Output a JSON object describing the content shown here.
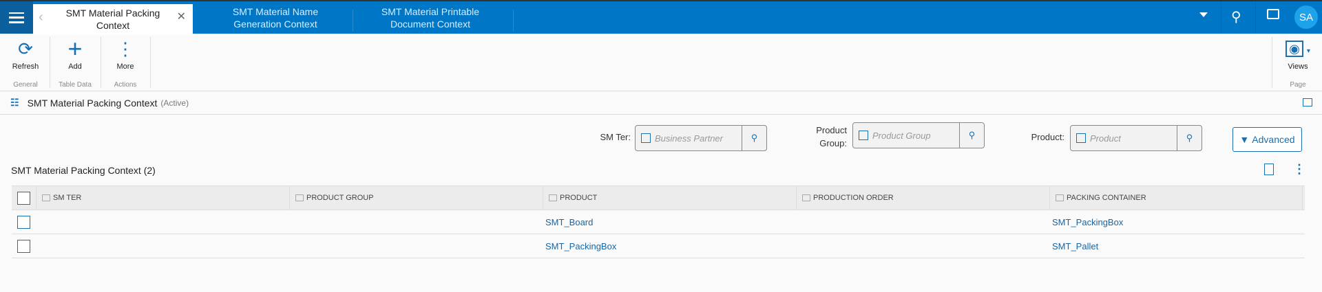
{
  "topbar": {
    "tabs": [
      {
        "label": "SMT Material Packing Context",
        "active": true
      },
      {
        "label": "SMT Material Name Generation Context"
      },
      {
        "label": "SMT Material Printable Document Context"
      }
    ],
    "avatar": "SA"
  },
  "toolbar": {
    "buttons": [
      {
        "label": "Refresh",
        "group": "General"
      },
      {
        "label": "Add",
        "group": "Table Data"
      },
      {
        "label": "More",
        "group": "Actions"
      },
      {
        "label": "Views",
        "group": "Page"
      }
    ]
  },
  "context": {
    "title": "SMT Material Packing Context",
    "status": "(Active)"
  },
  "filters": [
    {
      "label": "SM Ter:",
      "placeholder": "Business Partner"
    },
    {
      "label": "Product Group:",
      "placeholder": "Product Group"
    },
    {
      "label": "Product:",
      "placeholder": "Product"
    }
  ],
  "advanced_label": "Advanced",
  "table": {
    "title": "SMT Material Packing Context (2)",
    "columns": [
      "SM TER",
      "PRODUCT GROUP",
      "PRODUCT",
      "PRODUCTION ORDER",
      "PACKING CONTAINER"
    ],
    "rows": [
      [
        "",
        "",
        "SMT_Board",
        "",
        "SMT_PackingBox"
      ],
      [
        "",
        "",
        "SMT_PackingBox",
        "",
        "SMT_Pallet"
      ]
    ]
  }
}
